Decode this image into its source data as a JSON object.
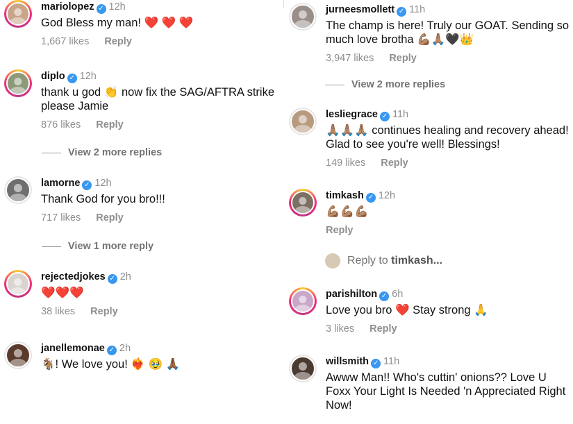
{
  "left": [
    {
      "user": "mariolopez",
      "time": "12h",
      "text": "God Bless my man! ❤️ ❤️ ❤️",
      "likes": "1,667 likes",
      "reply": "Reply"
    },
    {
      "user": "diplo",
      "time": "12h",
      "text": "thank u god 👏 now fix the SAG/AFTRA strike please Jamie",
      "likes": "876 likes",
      "reply": "Reply"
    },
    {
      "user": "lamorne",
      "time": "12h",
      "text": "Thank God for you bro!!!",
      "likes": "717 likes",
      "reply": "Reply"
    },
    {
      "user": "rejectedjokes",
      "time": "2h",
      "text": "❤️❤️❤️",
      "likes": "38 likes",
      "reply": "Reply"
    },
    {
      "user": "janellemonae",
      "time": "2h",
      "text": "🐐! We love you! ❤️‍🔥 🥹 🙏🏾"
    }
  ],
  "left_view_more": [
    "View 2 more replies",
    "View 1 more reply"
  ],
  "right": [
    {
      "user": "jurneesmollett",
      "time": "11h",
      "text": "The champ is here! Truly our GOAT. Sending so much love brotha 💪🏽🙏🏽🖤👑",
      "likes": "3,947 likes",
      "reply": "Reply"
    },
    {
      "user": "lesliegrace",
      "time": "11h",
      "text": "🙏🏽🙏🏽🙏🏽 continues healing and recovery ahead! Glad to see you're well! Blessings!",
      "likes": "149 likes",
      "reply": "Reply"
    },
    {
      "user": "timkash",
      "time": "12h",
      "text": "💪🏽💪🏽💪🏽",
      "reply": "Reply"
    },
    {
      "user": "parishilton",
      "time": "6h",
      "text": "Love you bro ❤️ Stay strong 🙏",
      "likes": "3 likes",
      "reply": "Reply"
    },
    {
      "user": "willsmith",
      "time": "11h",
      "text": "Awww Man!! Who's cuttin' onions?? Love U Foxx Your Light Is Needed 'n Appreciated Right Now!"
    }
  ],
  "right_view_more": "View 2 more replies",
  "reply_to": {
    "prefix": "Reply to",
    "user": "timkash..."
  },
  "colors": {
    "verified": "#3897f0",
    "muted": "#8e8e8e",
    "heart": "#e0241d"
  }
}
